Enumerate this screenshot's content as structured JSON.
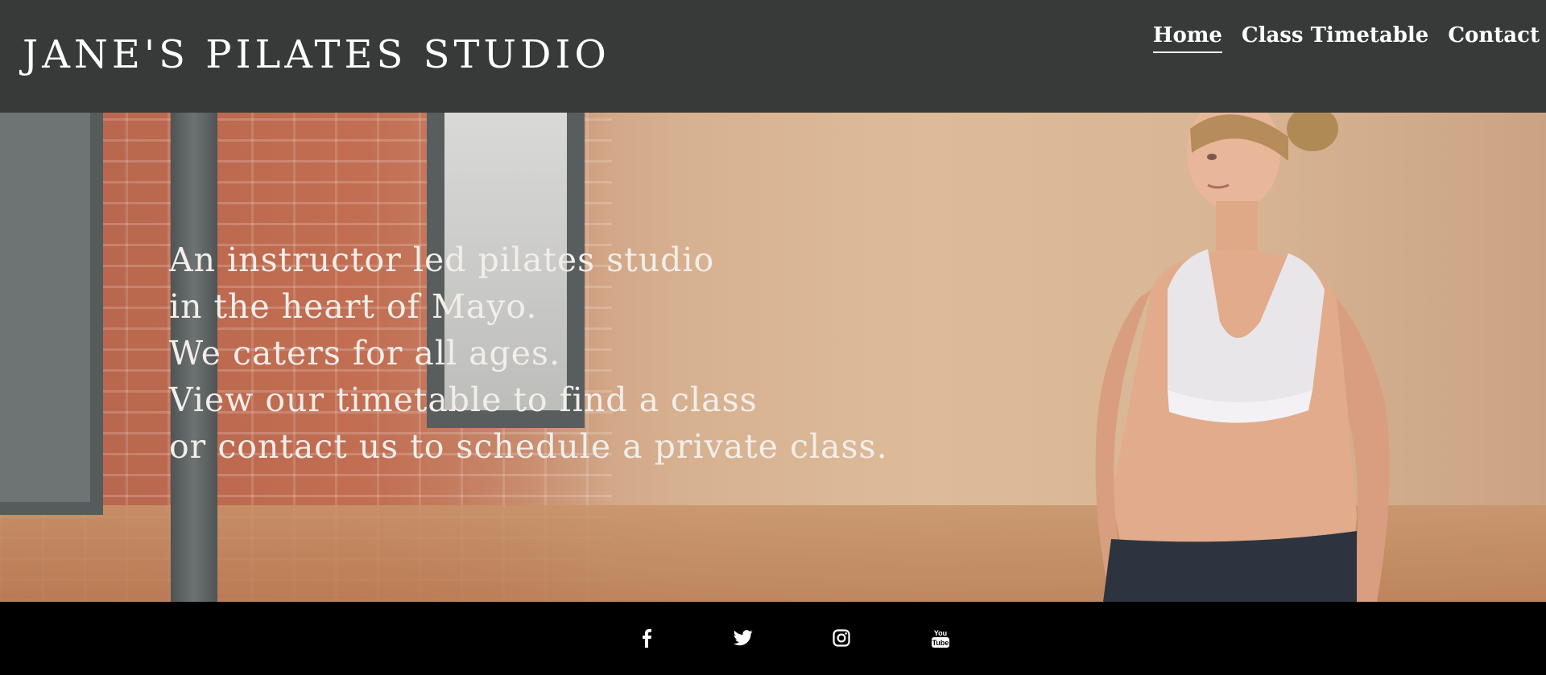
{
  "header": {
    "brand": "JANE'S PILATES STUDIO",
    "nav": [
      {
        "label": "Home",
        "active": true
      },
      {
        "label": "Class Timetable",
        "active": false
      },
      {
        "label": "Contact",
        "active": false
      }
    ]
  },
  "hero": {
    "lines": [
      "An instructor led pilates studio",
      "in the heart of Mayo.",
      "We caters for all ages.",
      "View our timetable to find a class",
      "or contact us to schedule a private class."
    ]
  },
  "footer": {
    "social": [
      {
        "icon": "facebook-icon"
      },
      {
        "icon": "twitter-icon"
      },
      {
        "icon": "instagram-icon"
      },
      {
        "icon": "youtube-icon",
        "text": "You Tube"
      }
    ]
  },
  "colors": {
    "header_bg": "#373a39",
    "footer_bg": "#000000",
    "text": "#ffffff"
  }
}
